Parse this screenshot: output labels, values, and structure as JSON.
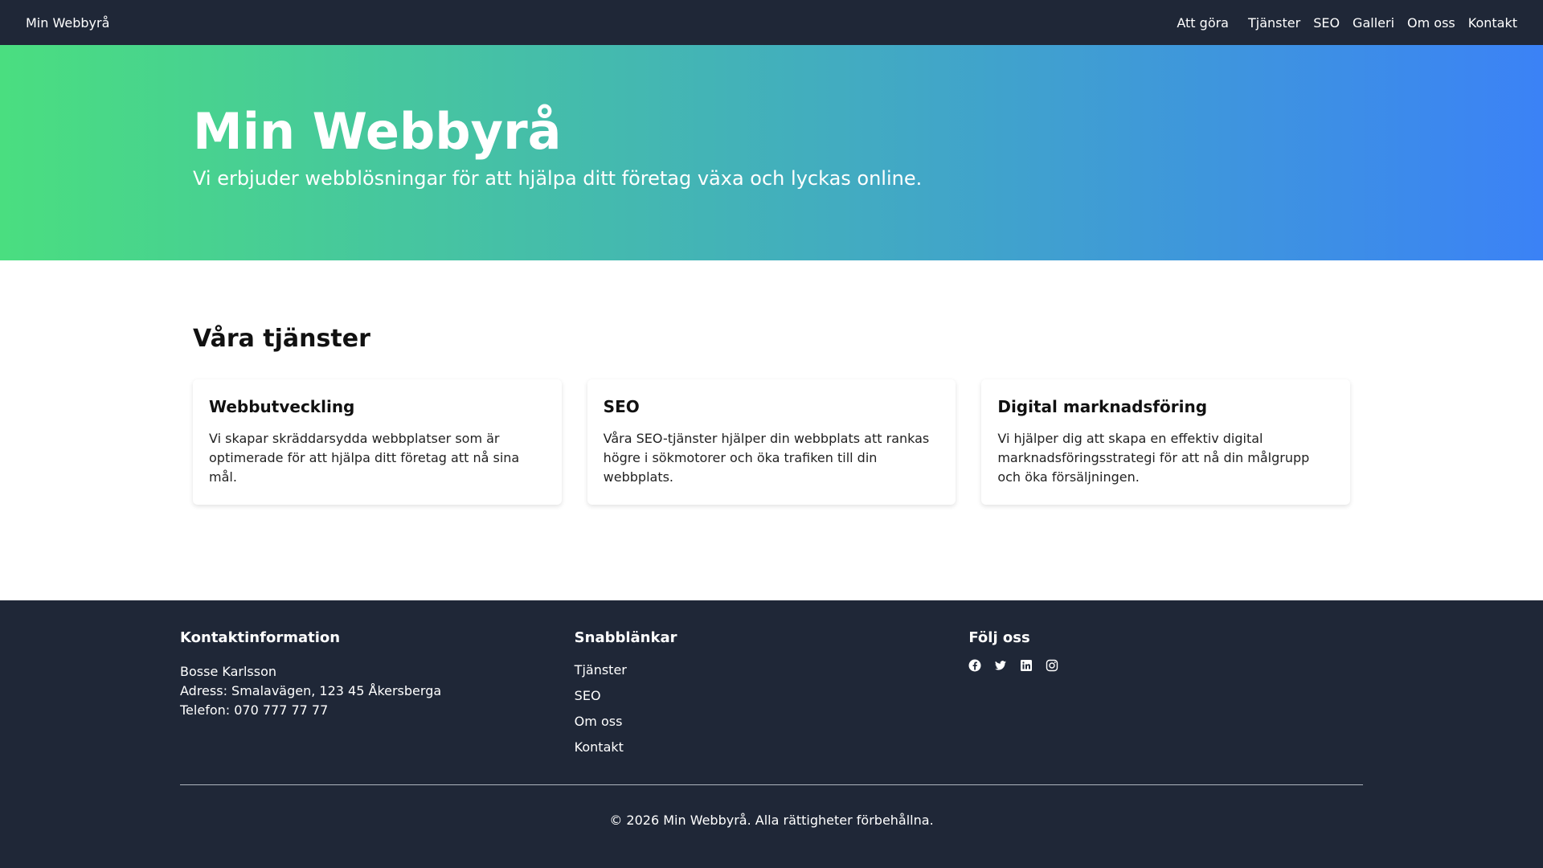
{
  "navbar": {
    "brand": "Min Webbyrå",
    "links": [
      "Att göra",
      "Tjänster",
      "SEO",
      "Galleri",
      "Om oss",
      "Kontakt"
    ]
  },
  "hero": {
    "title": "Min Webbyrå",
    "subtitle": "Vi erbjuder webblösningar för att hjälpa ditt företag växa och lyckas online."
  },
  "services": {
    "title": "Våra tjänster",
    "cards": [
      {
        "title": "Webbutveckling",
        "text": "Vi skapar skräddarsydda webbplatser som är optimerade för att hjälpa ditt företag att nå sina mål."
      },
      {
        "title": "SEO",
        "text": "Våra SEO-tjänster hjälper din webbplats att rankas högre i sökmotorer och öka trafiken till din webbplats."
      },
      {
        "title": "Digital marknadsföring",
        "text": "Vi hjälper dig att skapa en effektiv digital marknadsföringsstrategi för att nå din målgrupp och öka försäljningen."
      }
    ]
  },
  "footer": {
    "contact": {
      "heading": "Kontaktinformation",
      "name": "Bosse Karlsson",
      "address": "Adress: Smalavägen, 123 45 Åkersberga",
      "phone": "Telefon: 070 777 77 77"
    },
    "quicklinks": {
      "heading": "Snabblänkar",
      "links": [
        "Tjänster",
        "SEO",
        "Om oss",
        "Kontakt"
      ]
    },
    "follow": {
      "heading": "Följ oss",
      "icons": [
        "facebook-icon",
        "twitter-icon",
        "linkedin-icon",
        "instagram-icon"
      ]
    },
    "copyright": "© 2026 Min Webbyrå. Alla rättigheter förbehållna."
  },
  "colors": {
    "nav_bg": "#1f2737",
    "hero_gradient_start": "#4ade80",
    "hero_gradient_end": "#3b82f6",
    "footer_bg": "#1f2737"
  }
}
